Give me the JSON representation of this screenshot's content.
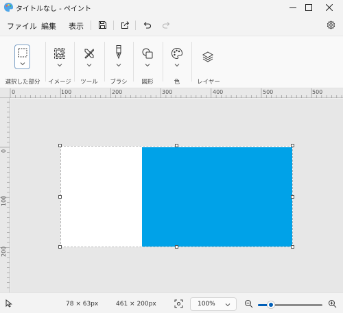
{
  "window": {
    "title": "タイトルなし - ペイント",
    "controls": [
      "minimize-icon",
      "maximize-icon",
      "close-icon"
    ]
  },
  "menu": {
    "items": [
      "ファイル",
      "編集",
      "表示"
    ],
    "icons": [
      "save-icon",
      "share-icon",
      "undo-icon",
      "redo-icon",
      "settings-icon"
    ]
  },
  "ribbon": {
    "groups": [
      {
        "label": "選択した部分",
        "icon": "selection-icon"
      },
      {
        "label": "イメージ",
        "icon": "image-icon"
      },
      {
        "label": "ツール",
        "icon": "tools-icon"
      },
      {
        "label": "ブラシ",
        "icon": "brush-icon"
      },
      {
        "label": "図形",
        "icon": "shapes-icon"
      },
      {
        "label": "色",
        "icon": "palette-icon"
      },
      {
        "label": "レイヤー",
        "icon": "layers-icon"
      }
    ]
  },
  "ruler": {
    "top_labels": [
      "0",
      "100",
      "200",
      "300",
      "400",
      "500"
    ],
    "left_labels": [
      "0",
      "100",
      "200"
    ]
  },
  "canvas": {
    "background": "#ffffff",
    "shape_color": "#00a2e8"
  },
  "status": {
    "cursor_icon": "pointer-icon",
    "selection_size": "78 × 63px",
    "canvas_size": "461 × 200px",
    "zoom_value": "100%",
    "zoom_level": 0.2,
    "accent": "#005fb8"
  }
}
